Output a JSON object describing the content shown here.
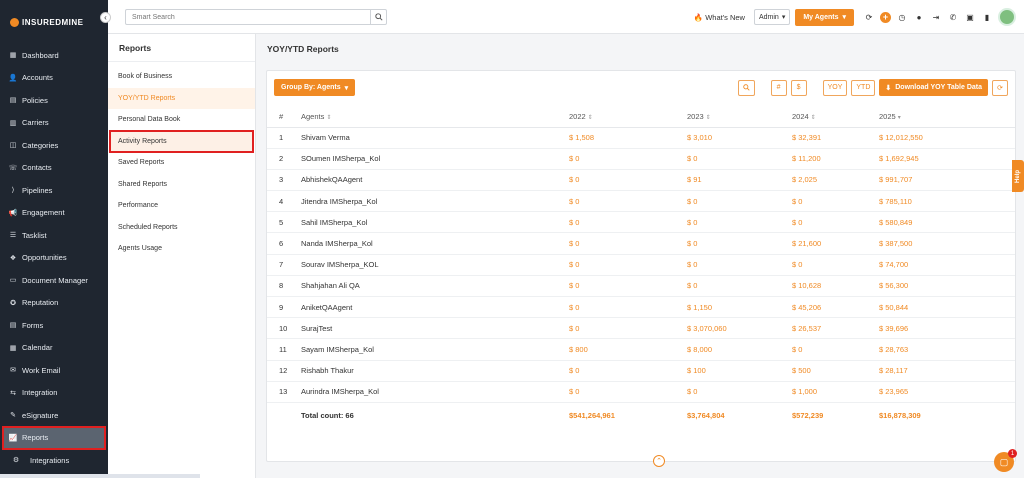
{
  "app": {
    "logo_text": "INSUREDMINE",
    "accent": "#f08a24",
    "sidebar_bg": "#1f2630",
    "highlight": "#e02020"
  },
  "sidebar": {
    "items": [
      {
        "label": "Dashboard",
        "icon": "dashboard-icon"
      },
      {
        "label": "Accounts",
        "icon": "accounts-icon"
      },
      {
        "label": "Policies",
        "icon": "policies-icon"
      },
      {
        "label": "Carriers",
        "icon": "carriers-icon"
      },
      {
        "label": "Categories",
        "icon": "categories-icon"
      },
      {
        "label": "Contacts",
        "icon": "contacts-icon"
      },
      {
        "label": "Pipelines",
        "icon": "pipelines-icon"
      },
      {
        "label": "Engagement",
        "icon": "megaphone-icon"
      },
      {
        "label": "Tasklist",
        "icon": "tasklist-icon"
      },
      {
        "label": "Opportunities",
        "icon": "opportunities-icon"
      },
      {
        "label": "Document Manager",
        "icon": "folder-icon"
      },
      {
        "label": "Reputation",
        "icon": "reputation-icon"
      },
      {
        "label": "Forms",
        "icon": "forms-icon"
      },
      {
        "label": "Calendar",
        "icon": "calendar-icon"
      },
      {
        "label": "Work Email",
        "icon": "email-icon"
      },
      {
        "label": "Integration",
        "icon": "integration-icon"
      },
      {
        "label": "eSignature",
        "icon": "signature-icon"
      },
      {
        "label": "Reports",
        "icon": "chart-icon"
      },
      {
        "label": "Integrations",
        "icon": "gears-icon"
      }
    ]
  },
  "topbar": {
    "search_placeholder": "Smart Search",
    "whats_new": "What's New",
    "admin_label": "Admin",
    "my_agents": "My Agents"
  },
  "reports_panel": {
    "title": "Reports",
    "links": [
      "Book of Business",
      "YOY/YTD Reports",
      "Personal Data Book",
      "Activity Reports",
      "Saved Reports",
      "Shared Reports",
      "Performance",
      "Scheduled Reports",
      "Agents Usage"
    ]
  },
  "main": {
    "title": "YOY/YTD Reports",
    "group_by": "Group By: Agents",
    "hash_label": "#",
    "dollar_label": "$",
    "yoy_label": "YOY",
    "ytd_label": "YTD",
    "download_label": "Download YOY Table Data"
  },
  "table": {
    "headers": [
      "#",
      "Agents",
      "2022",
      "2023",
      "2024",
      "2025"
    ],
    "rows": [
      [
        "1",
        "Shivam Verma",
        "$ 1,508",
        "$ 3,010",
        "$ 32,391",
        "$ 12,012,550"
      ],
      [
        "2",
        "SOumen IMSherpa_Kol",
        "$ 0",
        "$ 0",
        "$ 11,200",
        "$ 1,692,945"
      ],
      [
        "3",
        "AbhishekQAAgent",
        "$ 0",
        "$ 91",
        "$ 2,025",
        "$ 991,707"
      ],
      [
        "4",
        "Jitendra IMSherpa_Kol",
        "$ 0",
        "$ 0",
        "$ 0",
        "$ 785,110"
      ],
      [
        "5",
        "Sahil IMSherpa_Kol",
        "$ 0",
        "$ 0",
        "$ 0",
        "$ 580,849"
      ],
      [
        "6",
        "Nanda IMSherpa_Kol",
        "$ 0",
        "$ 0",
        "$ 21,600",
        "$ 387,500"
      ],
      [
        "7",
        "Sourav IMSherpa_KOL",
        "$ 0",
        "$ 0",
        "$ 0",
        "$ 74,700"
      ],
      [
        "8",
        "Shahjahan Ali QA",
        "$ 0",
        "$ 0",
        "$ 10,628",
        "$ 56,300"
      ],
      [
        "9",
        "AniketQAAgent",
        "$ 0",
        "$ 1,150",
        "$ 45,206",
        "$ 50,844"
      ],
      [
        "10",
        "SurajTest",
        "$ 0",
        "$ 3,070,060",
        "$ 26,537",
        "$ 39,696"
      ],
      [
        "11",
        "Sayam IMSherpa_Kol",
        "$ 800",
        "$ 8,000",
        "$ 0",
        "$ 28,763"
      ],
      [
        "12",
        "Rishabh Thakur",
        "$ 0",
        "$ 100",
        "$ 500",
        "$ 28,117"
      ],
      [
        "13",
        "Aurindra IMSherpa_Kol",
        "$ 0",
        "$ 0",
        "$ 1,000",
        "$ 23,965"
      ]
    ],
    "total": {
      "label": "Total count: 66",
      "y2022": "$541,264,961",
      "y2023": "$3,764,804",
      "y2024": "$572,239",
      "y2025": "$16,878,309"
    }
  },
  "help_tab": "Help",
  "chat_badge": "1"
}
